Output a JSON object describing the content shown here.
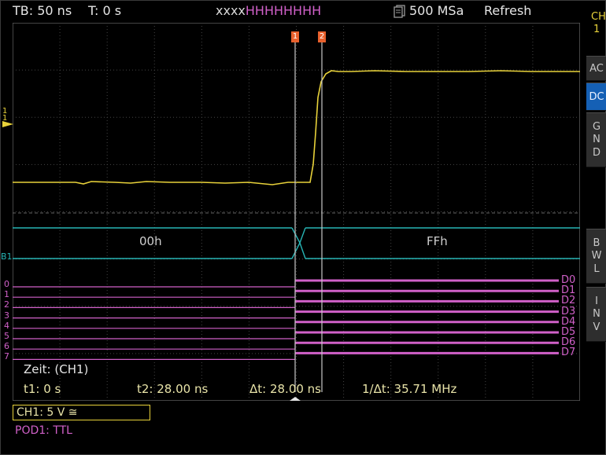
{
  "header": {
    "timebase": "TB: 50 ns",
    "trigger_time": "T: 0 s",
    "pattern_prefix": "xxxx",
    "pattern_suffix": "HHHHHHHH",
    "sample_icon": "memory-icon",
    "sample_rate": "500 MSa",
    "acquisition_mode": "Refresh"
  },
  "sidebar": {
    "channel_label_line1": "CH",
    "channel_label_line2": "1",
    "buttons": [
      {
        "label": "AC",
        "active": false
      },
      {
        "label": "DC",
        "active": true
      },
      {
        "label": "G\nN\nD",
        "active": false
      },
      {
        "label": "B\nW\nL",
        "active": false
      },
      {
        "label": "I\nN\nV",
        "active": false
      }
    ]
  },
  "markers": {
    "cursor1": "1",
    "cursor2": "2",
    "ch1_level_marker": "1",
    "bus_marker": "B1"
  },
  "bus": {
    "value_before": "00h",
    "value_after": "FFh"
  },
  "digital": {
    "left_labels": [
      "0",
      "1",
      "2",
      "3",
      "4",
      "5",
      "6",
      "7"
    ],
    "right_labels": [
      "D0",
      "D1",
      "D2",
      "D3",
      "D4",
      "D5",
      "D6",
      "D7"
    ]
  },
  "measurement": {
    "title": "Zeit: (CH1)",
    "t1": "t1: 0 s",
    "t2": "t2: 28.00 ns",
    "dt": "Δt: 28.00 ns",
    "inv_dt": "1/Δt: 35.71 MHz"
  },
  "footer": {
    "ch1_setting": "CH1: 5 V ≅",
    "pod_setting": "POD1: TTL"
  },
  "colors": {
    "ch1": "#e8d23a",
    "bus": "#27b4b4",
    "digital": "#d060c8",
    "grid": "#5a5a5a",
    "cursor": "#c8c8c8",
    "cursor_marker": "#e8602c",
    "active_button": "#1560b5"
  }
}
